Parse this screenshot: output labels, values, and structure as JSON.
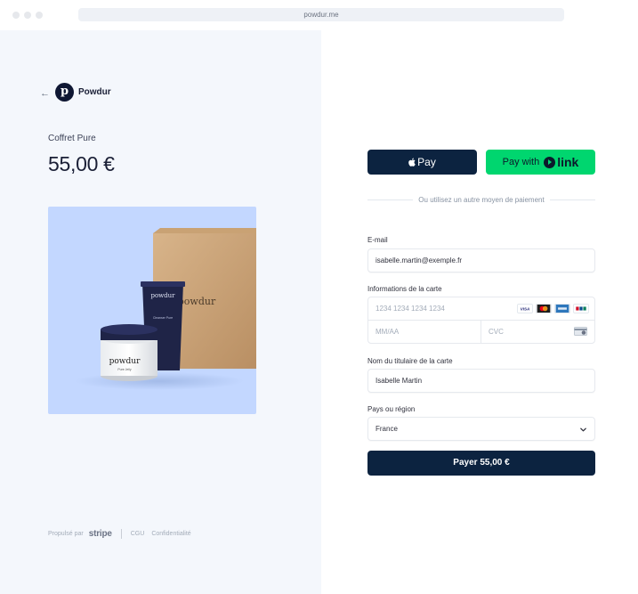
{
  "browser": {
    "url": "powdur.me"
  },
  "merchant": {
    "name": "Powdur",
    "logo_letter": "p"
  },
  "product": {
    "name": "Coffret Pure",
    "price": "55,00 €",
    "box_brand": "powdur",
    "tube_brand": "powdur",
    "tube_label": "Cleanser Pure",
    "jar_brand": "powdur",
    "jar_label": "Pure Jelly"
  },
  "footer": {
    "powered_by": "Propulsé par",
    "stripe": "stripe",
    "terms": "CGU",
    "privacy": "Confidentialité"
  },
  "payment": {
    "apple_pay_label": "Pay",
    "link_prefix": "Pay with",
    "link_word": "link",
    "divider_text": "Ou utilisez un autre moyen de paiement",
    "email": {
      "label": "E-mail",
      "value": "isabelle.martin@exemple.fr"
    },
    "card": {
      "label": "Informations de la carte",
      "number_placeholder": "1234 1234 1234 1234",
      "expiry_placeholder": "MM/AA",
      "cvc_placeholder": "CVC",
      "brands": [
        "VISA",
        "mastercard",
        "amex",
        "unionpay"
      ]
    },
    "cardholder": {
      "label": "Nom du titulaire de la carte",
      "value": "Isabelle Martin"
    },
    "country": {
      "label": "Pays ou région",
      "value": "France"
    },
    "pay_button": "Payer 55,00 €"
  },
  "colors": {
    "left_bg": "#f4f7fc",
    "primary": "#0c2340",
    "link_green": "#00d66f",
    "product_bg": "#c3d7ff"
  }
}
